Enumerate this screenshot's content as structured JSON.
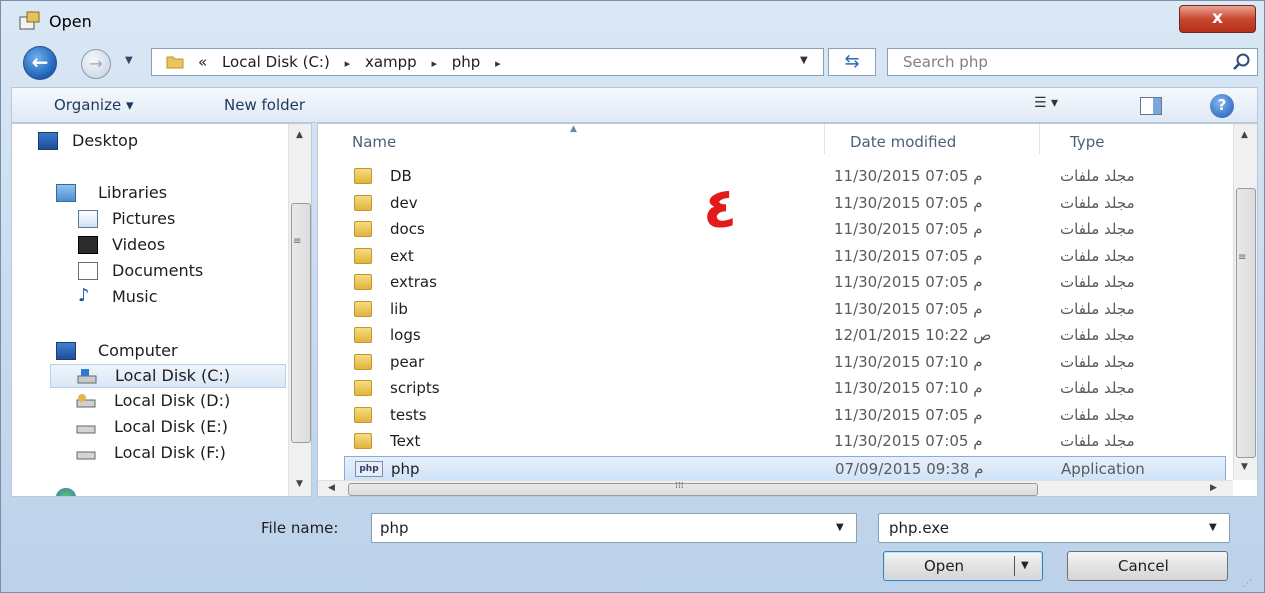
{
  "window": {
    "title": "Open",
    "close_label": "x"
  },
  "address": {
    "path": [
      "«",
      "Local Disk (C:)",
      "▸",
      "xampp",
      "▸",
      "php",
      "▸"
    ]
  },
  "search": {
    "placeholder": "Search php"
  },
  "toolbar": {
    "organize": "Organize ▾",
    "new_folder": "New folder",
    "views": "▾"
  },
  "nav": {
    "desktop": "Desktop",
    "libraries": "Libraries",
    "pictures": "Pictures",
    "videos": "Videos",
    "documents": "Documents",
    "music": "Music",
    "computer": "Computer",
    "disk_c": "Local Disk (C:)",
    "disk_d": "Local Disk (D:)",
    "disk_e": "Local Disk (E:)",
    "disk_f": "Local Disk (F:)"
  },
  "columns": {
    "name": "Name",
    "date": "Date modified",
    "type": "Type"
  },
  "files": [
    {
      "name": "DB",
      "date": "11/30/2015 07:05 م",
      "type": "مجلد ملفات",
      "icon": "folder-icon"
    },
    {
      "name": "dev",
      "date": "11/30/2015 07:05 م",
      "type": "مجلد ملفات",
      "icon": "folder-icon"
    },
    {
      "name": "docs",
      "date": "11/30/2015 07:05 م",
      "type": "مجلد ملفات",
      "icon": "folder-icon"
    },
    {
      "name": "ext",
      "date": "11/30/2015 07:05 م",
      "type": "مجلد ملفات",
      "icon": "folder-icon"
    },
    {
      "name": "extras",
      "date": "11/30/2015 07:05 م",
      "type": "مجلد ملفات",
      "icon": "folder-icon"
    },
    {
      "name": "lib",
      "date": "11/30/2015 07:05 م",
      "type": "مجلد ملفات",
      "icon": "folder-icon"
    },
    {
      "name": "logs",
      "date": "12/01/2015 10:22 ص",
      "type": "مجلد ملفات",
      "icon": "folder-icon"
    },
    {
      "name": "pear",
      "date": "11/30/2015 07:10 م",
      "type": "مجلد ملفات",
      "icon": "folder-icon"
    },
    {
      "name": "scripts",
      "date": "11/30/2015 07:10 م",
      "type": "مجلد ملفات",
      "icon": "folder-icon"
    },
    {
      "name": "tests",
      "date": "11/30/2015 07:05 م",
      "type": "مجلد ملفات",
      "icon": "folder-icon"
    },
    {
      "name": "Text",
      "date": "11/30/2015 07:05 م",
      "type": "مجلد ملفات",
      "icon": "folder-icon"
    },
    {
      "name": "php",
      "date": "07/09/2015 09:38 م",
      "type": "Application",
      "icon": "php-file-icon",
      "selected": true
    }
  ],
  "php_icon_text": "php",
  "annotation": "٤",
  "bottom": {
    "file_name_label": "File name:",
    "file_name_value": "php",
    "filter_value": "php.exe",
    "open_label": "Open",
    "cancel_label": "Cancel"
  }
}
